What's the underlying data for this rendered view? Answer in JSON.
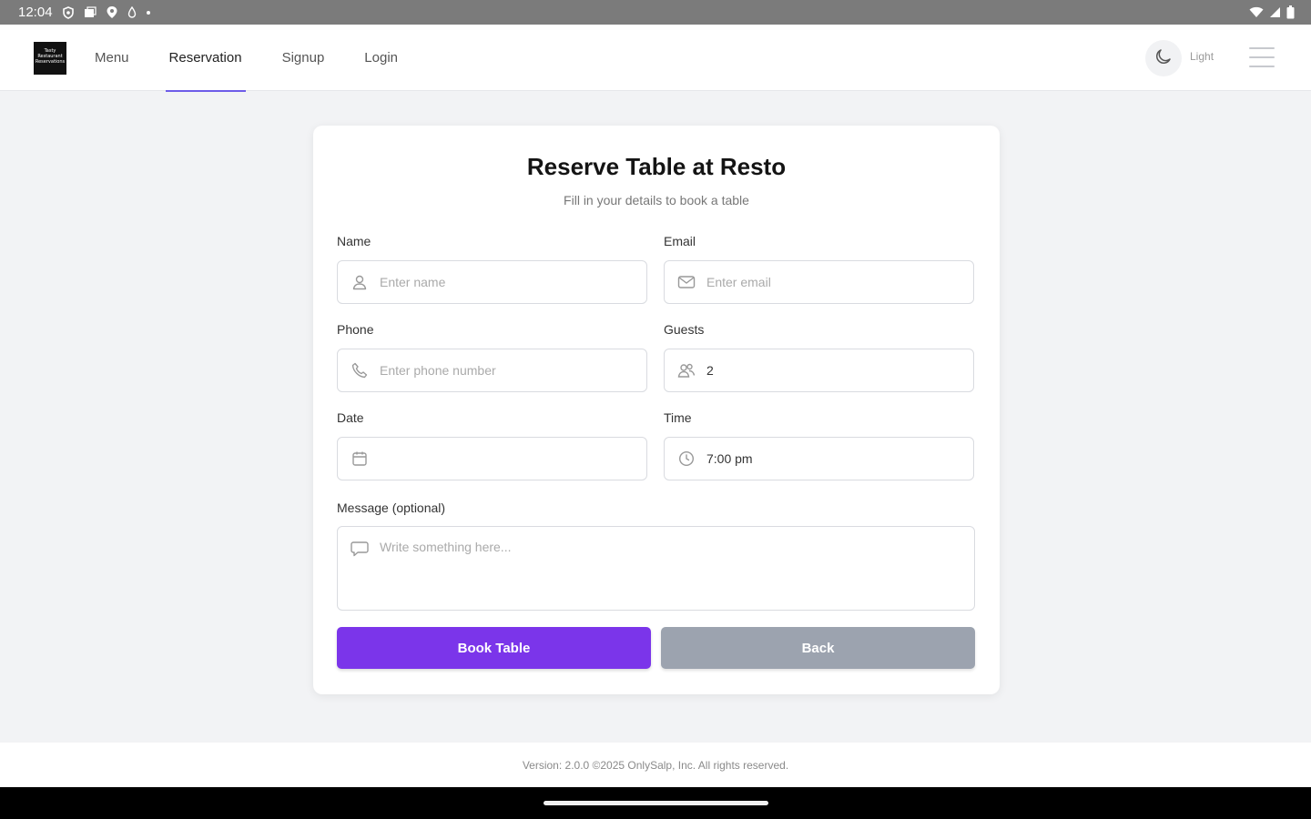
{
  "status_bar": {
    "time": "12:04",
    "icons_left": [
      "location-shield-icon",
      "image-gallery-icon",
      "maps-pin-icon",
      "drop-icon",
      "dot-icon"
    ],
    "icons_right": [
      "wifi-icon",
      "cell-signal-icon",
      "battery-icon"
    ]
  },
  "header": {
    "logo_text": "Tasty Restaurant Reservations",
    "nav": [
      {
        "label": "Menu",
        "active": false
      },
      {
        "label": "Reservation",
        "active": true
      },
      {
        "label": "Signup",
        "active": false
      },
      {
        "label": "Login",
        "active": false
      }
    ],
    "theme_icon": "moon-icon",
    "theme_label": "Light",
    "menu_icon": "hamburger-icon"
  },
  "form": {
    "title": "Reserve Table at Resto",
    "subtitle": "Fill in your details to book a table",
    "name": {
      "label": "Name",
      "placeholder": "Enter name",
      "icon": "user-icon"
    },
    "email": {
      "label": "Email",
      "placeholder": "Enter email",
      "icon": "mail-icon"
    },
    "phone": {
      "label": "Phone",
      "placeholder": "Enter phone number",
      "icon": "phone-icon"
    },
    "guests": {
      "label": "Guests",
      "value": "2",
      "icon": "users-icon"
    },
    "date": {
      "label": "Date",
      "value": "",
      "icon": "calendar-icon"
    },
    "time": {
      "label": "Time",
      "value": "7:00 pm",
      "icon": "clock-icon"
    },
    "message": {
      "label": "Message (optional)",
      "placeholder": "Write something here...",
      "icon": "chat-bubble-icon"
    },
    "submit_label": "Book Table",
    "back_label": "Back"
  },
  "footer": {
    "text": "Version: 2.0.0 ©2025 OnlySalp, Inc. All rights reserved."
  },
  "colors": {
    "primary": "#7b35ea",
    "secondary": "#9ca3af",
    "nav_active_underline": "#6d5ce8",
    "background": "#f2f3f5"
  }
}
